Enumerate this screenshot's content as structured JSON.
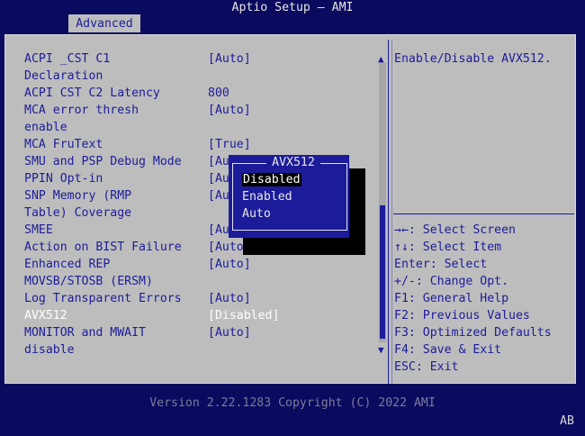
{
  "header": {
    "title": "Aptio Setup – AMI",
    "tab": "Advanced"
  },
  "settings": [
    {
      "label": "ACPI _CST C1",
      "value": "[Auto]"
    },
    {
      "label": "Declaration",
      "value": ""
    },
    {
      "label": "ACPI CST C2 Latency",
      "value": "800"
    },
    {
      "label": "MCA error thresh",
      "value": "[Auto]"
    },
    {
      "label": "enable",
      "value": ""
    },
    {
      "label": "MCA FruText",
      "value": "[True]"
    },
    {
      "label": "SMU and PSP Debug Mode",
      "value": "[Au"
    },
    {
      "label": "PPIN Opt-in",
      "value": "[Au"
    },
    {
      "label": "SNP Memory (RMP",
      "value": "[Au"
    },
    {
      "label": "Table) Coverage",
      "value": ""
    },
    {
      "label": "SMEE",
      "value": "[Au"
    },
    {
      "label": "Action on BIST Failure",
      "value": "[Auto"
    },
    {
      "label": "Enhanced REP",
      "value": "[Auto]"
    },
    {
      "label": "MOVSB/STOSB (ERSM)",
      "value": ""
    },
    {
      "label": "Log Transparent Errors",
      "value": "[Auto]"
    },
    {
      "label": "AVX512",
      "value": "[Disabled]"
    },
    {
      "label": "MONITOR and MWAIT",
      "value": "[Auto]"
    },
    {
      "label": "disable",
      "value": ""
    }
  ],
  "help": {
    "description": "Enable/Disable AVX512.",
    "keys": [
      "→←: Select Screen",
      "↑↓: Select Item",
      "Enter: Select",
      "+/-: Change Opt.",
      "F1: General Help",
      "F2: Previous Values",
      "F3: Optimized Defaults",
      "F4: Save & Exit",
      "ESC: Exit"
    ]
  },
  "popup": {
    "title": "AVX512",
    "options": [
      "Disabled",
      "Enabled",
      "Auto"
    ],
    "selected": "Disabled"
  },
  "footer": {
    "version": "Version 2.22.1283 Copyright (C) 2022 AMI",
    "badge": "AB"
  },
  "scroll": {
    "up_arrow": "▲",
    "down_arrow": "▼"
  },
  "colors": {
    "background": "#0a0a5e",
    "panel": "#bdbdbd",
    "text": "#1c1c9a",
    "highlight": "#ffffff"
  }
}
